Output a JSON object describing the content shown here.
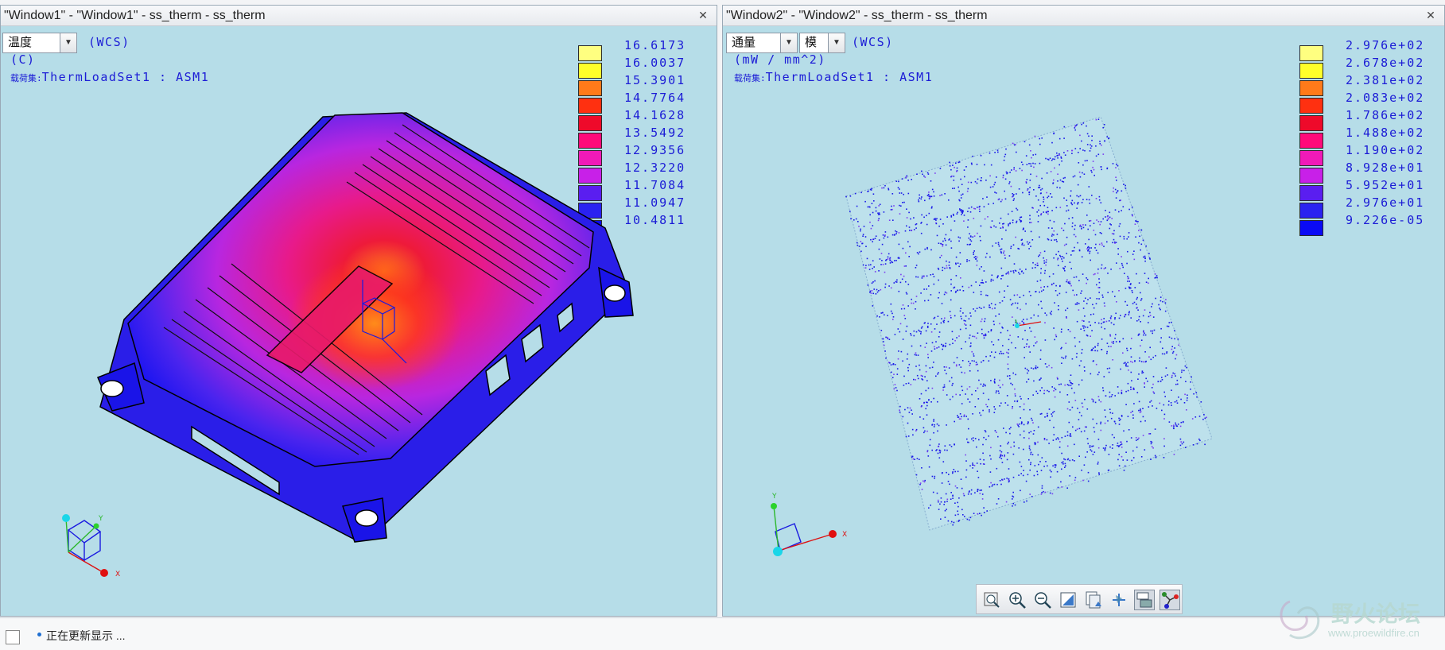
{
  "window1": {
    "title": "\"Window1\" - \"Window1\" - ss_therm - ss_therm",
    "quantity_label": "温度",
    "coord_system": "(WCS)",
    "units": "(C)",
    "load_set_prefix": "载荷集:",
    "load_set": "ThermLoadSet1  :   ASM1",
    "legend": [
      {
        "value": "16.6173",
        "color": "#ffff80"
      },
      {
        "value": "16.0037",
        "color": "#ffff2a"
      },
      {
        "value": "15.3901",
        "color": "#ff7a1a"
      },
      {
        "value": "14.7764",
        "color": "#ff3010"
      },
      {
        "value": "14.1628",
        "color": "#ee0a2a"
      },
      {
        "value": "13.5492",
        "color": "#ff0a7a"
      },
      {
        "value": "12.9356",
        "color": "#f01ab8"
      },
      {
        "value": "12.3220",
        "color": "#c820e8"
      },
      {
        "value": "11.7084",
        "color": "#5a1ef0"
      },
      {
        "value": "11.0947",
        "color": "#2a22f0"
      },
      {
        "value": "10.4811",
        "color": "#0a0af5"
      }
    ],
    "triad_labels": {
      "x": "X",
      "y": "Y"
    }
  },
  "window2": {
    "title": "\"Window2\" - \"Window2\" - ss_therm - ss_therm",
    "quantity_label": "通量",
    "component_label": "模",
    "coord_system": "(WCS)",
    "units": "(mW / mm^2)",
    "load_set_prefix": "载荷集:",
    "load_set": "ThermLoadSet1  :   ASM1",
    "legend": [
      {
        "value": "2.976e+02",
        "color": "#ffff80"
      },
      {
        "value": "2.678e+02",
        "color": "#ffff2a"
      },
      {
        "value": "2.381e+02",
        "color": "#ff7a1a"
      },
      {
        "value": "2.083e+02",
        "color": "#ff3010"
      },
      {
        "value": "1.786e+02",
        "color": "#ee0a2a"
      },
      {
        "value": "1.488e+02",
        "color": "#ff0a7a"
      },
      {
        "value": "1.190e+02",
        "color": "#f01ab8"
      },
      {
        "value": "8.928e+01",
        "color": "#c820e8"
      },
      {
        "value": "5.952e+01",
        "color": "#5a1ef0"
      },
      {
        "value": "2.976e+01",
        "color": "#2a22f0"
      },
      {
        "value": "9.226e-05",
        "color": "#0a0af5"
      }
    ],
    "triad_labels": {
      "x": "X",
      "y": "Y"
    }
  },
  "toolbar": {
    "buttons": [
      {
        "name": "zoom-fit-button",
        "icon": "zoom-fit-icon"
      },
      {
        "name": "zoom-in-button",
        "icon": "zoom-in-icon"
      },
      {
        "name": "zoom-out-button",
        "icon": "zoom-out-icon"
      },
      {
        "name": "repaint-button",
        "icon": "repaint-icon"
      },
      {
        "name": "saved-views-button",
        "icon": "saved-views-icon"
      },
      {
        "name": "datum-display-button",
        "icon": "datum-display-icon"
      },
      {
        "name": "display-style-button",
        "icon": "display-style-icon"
      },
      {
        "name": "spin-center-button",
        "icon": "spin-center-icon"
      }
    ]
  },
  "statusbar": {
    "message": "正在更新显示 ..."
  },
  "watermark": {
    "text": "野火论坛",
    "url": "www.proewildfire.cn"
  },
  "colors": {
    "viewport_bg": "#b6dde8",
    "hud_text": "#1b1bd6"
  }
}
